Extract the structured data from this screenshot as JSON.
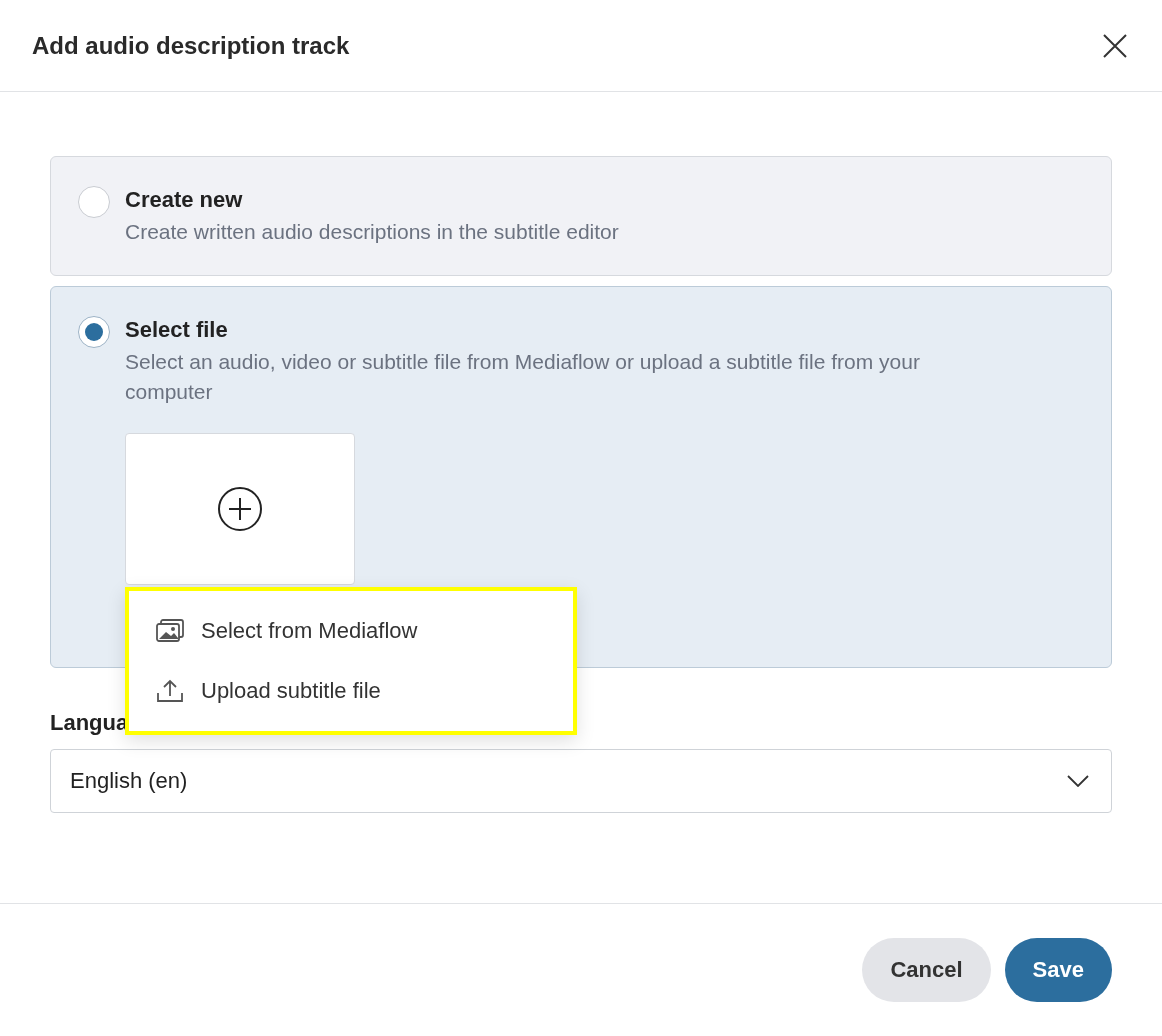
{
  "dialog": {
    "title": "Add audio description track"
  },
  "options": [
    {
      "title": "Create new",
      "description": "Create written audio descriptions in the subtitle editor",
      "selected": false
    },
    {
      "title": "Select file",
      "description": "Select an audio, video or subtitle file from Mediaflow or upload a subtitle file from your computer",
      "selected": true,
      "menu": {
        "highlighted": true,
        "items": [
          {
            "kind": "media",
            "label": "Select from Mediaflow"
          },
          {
            "kind": "upload",
            "label": "Upload subtitle file"
          }
        ]
      }
    }
  ],
  "language": {
    "label": "Langua",
    "value": "English (en)"
  },
  "buttons": [
    {
      "kind": "secondary",
      "label": "Cancel"
    },
    {
      "kind": "primary",
      "label": "Save"
    }
  ]
}
